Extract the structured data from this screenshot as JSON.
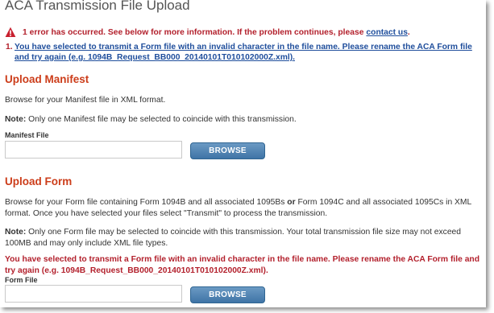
{
  "page": {
    "title": "ACA Transmission File Upload"
  },
  "alert": {
    "summary": "1 error has occurred. See below for more information. If the problem continues, please",
    "contact_link": "contact us",
    "contact_suffix": ".",
    "items": [
      {
        "number": "1.",
        "text": "You have selected to transmit a Form file with an invalid character in the file name. Please rename the ACA Form file and try again (e.g. 1094B_Request_BB000_20140101T010102000Z.xml)."
      }
    ],
    "icon": "warning-triangle-icon",
    "error_color": "#b3212d",
    "link_color": "#1f4e9c"
  },
  "manifest": {
    "heading": "Upload Manifest",
    "instructions": "Browse for your Manifest file in XML format.",
    "note_label": "Note:",
    "note_text": " Only one Manifest file may be selected to coincide with this transmission.",
    "field_label": "Manifest File",
    "field_value": "",
    "browse_label": "BROWSE"
  },
  "form": {
    "heading": "Upload Form",
    "instructions_part1": "Browse for your Form file containing Form 1094B and all associated 1095Bs ",
    "instructions_or": "or",
    "instructions_part2": " Form 1094C and all associated 1095Cs in XML format. Once you have selected your files select \"Transmit\" to process the transmission.",
    "note_label": "Note:",
    "note_text": " Only one Form file may be selected to coincide with this transmission. Your total transmission file size may not exceed 100MB and may only include XML file types.",
    "error_text": "You have selected to transmit a Form file with an invalid character in the file name. Please rename the ACA Form file and try again (e.g. 1094B_Request_BB000_20140101T010102000Z.xml).",
    "field_label": "Form File",
    "field_value": "",
    "browse_label": "BROWSE"
  },
  "theme": {
    "heading_color": "#cc3d1a",
    "button_color": "#4a7fb0"
  }
}
